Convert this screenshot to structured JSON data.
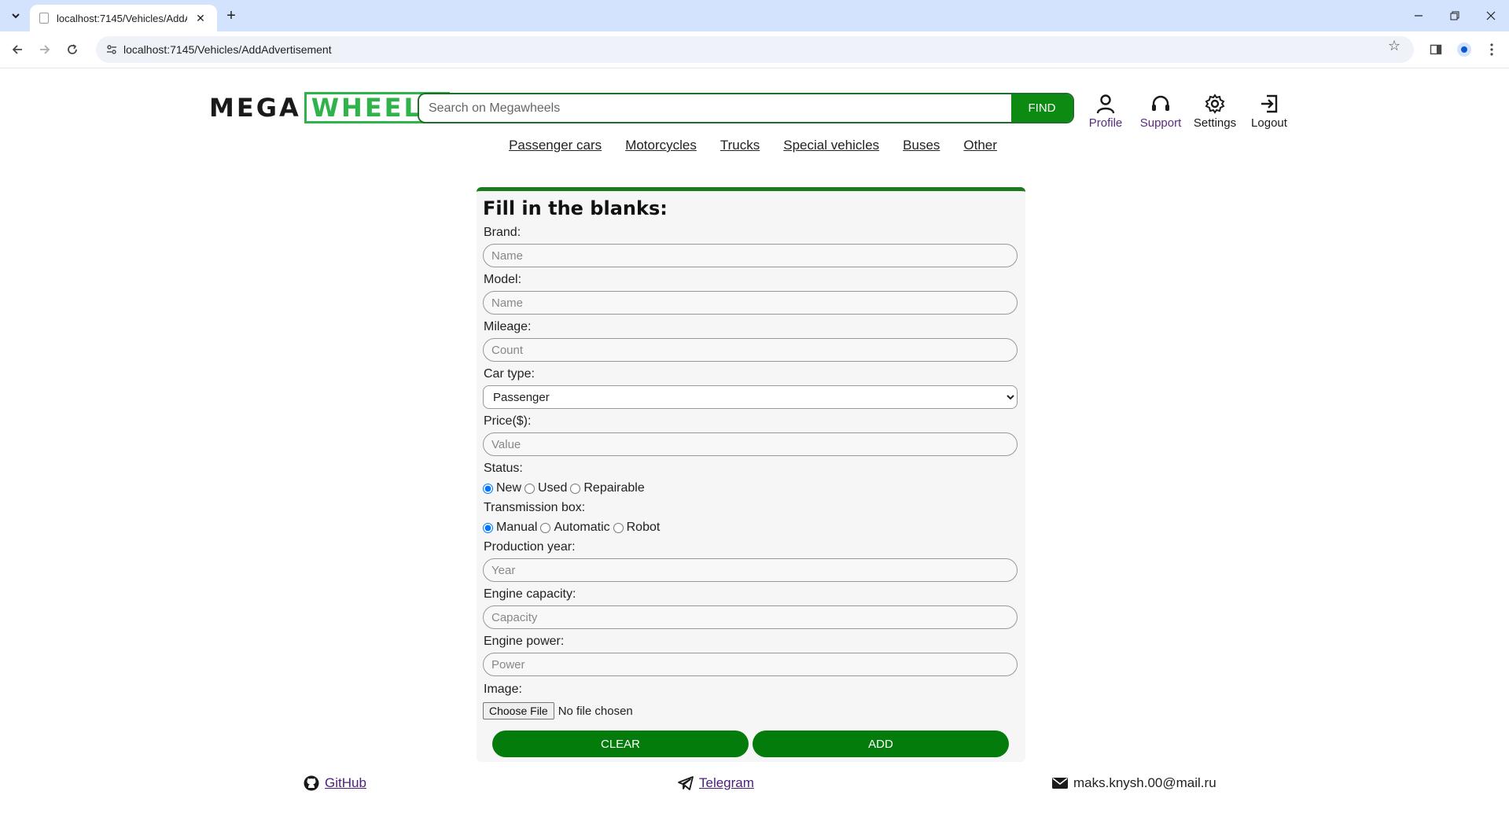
{
  "browser": {
    "tab_title": "localhost:7145/Vehicles/AddA",
    "url": "localhost:7145/Vehicles/AddAdvertisement"
  },
  "header": {
    "logo_mega": "MEGA",
    "logo_wheels": "WHEELS",
    "search_placeholder": "Search on Megawheels",
    "find_label": "FIND",
    "actions": {
      "profile": "Profile",
      "support": "Support",
      "settings": "Settings",
      "logout": "Logout"
    }
  },
  "categories": [
    "Passenger cars",
    "Motorcycles",
    "Trucks",
    "Special vehicles",
    "Buses",
    "Other"
  ],
  "form": {
    "title": "Fill in the blanks:",
    "brand_label": "Brand:",
    "brand_placeholder": "Name",
    "model_label": "Model:",
    "model_placeholder": "Name",
    "mileage_label": "Mileage:",
    "mileage_placeholder": "Count",
    "car_type_label": "Car type:",
    "car_type_value": "Passenger",
    "price_label": "Price($):",
    "price_placeholder": "Value",
    "status_label": "Status:",
    "status_options": [
      "New",
      "Used",
      "Repairable"
    ],
    "transmission_label": "Transmission box:",
    "transmission_options": [
      "Manual",
      "Automatic",
      "Robot"
    ],
    "year_label": "Production year:",
    "year_placeholder": "Year",
    "capacity_label": "Engine capacity:",
    "capacity_placeholder": "Capacity",
    "power_label": "Engine power:",
    "power_placeholder": "Power",
    "image_label": "Image:",
    "file_button": "Choose File",
    "file_status": "No file chosen",
    "clear_label": "CLEAR",
    "add_label": "ADD"
  },
  "footer": {
    "github": "GitHub",
    "telegram": "Telegram",
    "email": "maks.knysh.00@mail.ru"
  },
  "colors": {
    "brand_green": "#0d8a12",
    "logo_green": "#2fb34a",
    "link_purple": "#5a2a82",
    "browser_tabstrip": "#d3e3fd"
  }
}
